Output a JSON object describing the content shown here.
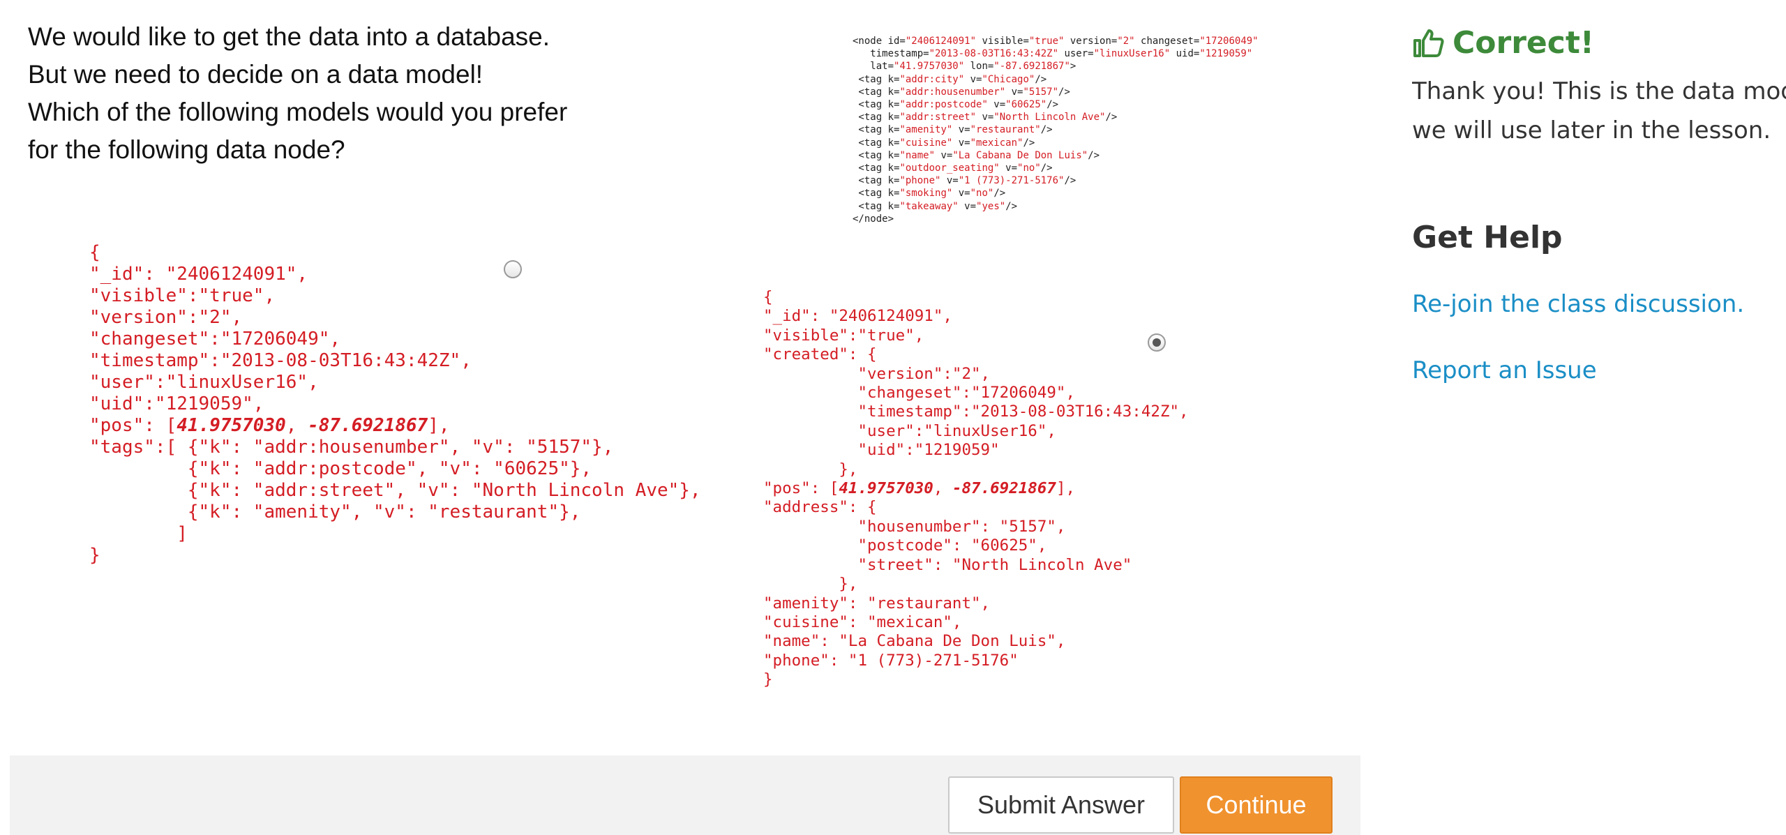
{
  "question": {
    "lines": [
      "We would like to get the data into a database.",
      "But we need to decide on a data model!",
      "Which of the following models would you prefer",
      "for the following data node?"
    ]
  },
  "xml_node": {
    "lines": [
      "<node id=\"2406124091\" visible=\"true\" version=\"2\" changeset=\"17206049\"",
      "   timestamp=\"2013-08-03T16:43:42Z\" user=\"linuxUser16\" uid=\"1219059\"",
      "   lat=\"41.9757030\" lon=\"-87.6921867\">",
      " <tag k=\"addr:city\" v=\"Chicago\"/>",
      " <tag k=\"addr:housenumber\" v=\"5157\"/>",
      " <tag k=\"addr:postcode\" v=\"60625\"/>",
      " <tag k=\"addr:street\" v=\"North Lincoln Ave\"/>",
      " <tag k=\"amenity\" v=\"restaurant\"/>",
      " <tag k=\"cuisine\" v=\"mexican\"/>",
      " <tag k=\"name\" v=\"La Cabana De Don Luis\"/>",
      " <tag k=\"outdoor_seating\" v=\"no\"/>",
      " <tag k=\"phone\" v=\"1 (773)-271-5176\"/>",
      " <tag k=\"smoking\" v=\"no\"/>",
      " <tag k=\"takeaway\" v=\"yes\"/>",
      "</node>"
    ]
  },
  "option_a": {
    "selected": false,
    "lines": [
      "{",
      "\"_id\": \"2406124091\",",
      "\"visible\":\"true\",",
      "\"version\":\"2\",",
      "\"changeset\":\"17206049\",",
      "\"timestamp\":\"2013-08-03T16:43:42Z\",",
      "\"user\":\"linuxUser16\",",
      "\"uid\":\"1219059\",",
      "\"pos\": [41.9757030, -87.6921867],",
      "\"tags\":[ {\"k\": \"addr:housenumber\", \"v\": \"5157\"},",
      "         {\"k\": \"addr:postcode\", \"v\": \"60625\"},",
      "         {\"k\": \"addr:street\", \"v\": \"North Lincoln Ave\"},",
      "         {\"k\": \"amenity\", \"v\": \"restaurant\"},",
      "        ]",
      "}"
    ]
  },
  "option_b": {
    "selected": true,
    "lines": [
      "{",
      "\"_id\": \"2406124091\",",
      "\"visible\":\"true\",",
      "\"created\": {",
      "          \"version\":\"2\",",
      "          \"changeset\":\"17206049\",",
      "          \"timestamp\":\"2013-08-03T16:43:42Z\",",
      "          \"user\":\"linuxUser16\",",
      "          \"uid\":\"1219059\"",
      "        },",
      "\"pos\": [41.9757030, -87.6921867],",
      "\"address\": {",
      "          \"housenumber\": \"5157\",",
      "          \"postcode\": \"60625\",",
      "          \"street\": \"North Lincoln Ave\"",
      "        },",
      "\"amenity\": \"restaurant\",",
      "\"cuisine\": \"mexican\",",
      "\"name\": \"La Cabana De Don Luis\",",
      "\"phone\": \"1 (773)-271-5176\"",
      "}"
    ]
  },
  "footer": {
    "submit_label": "Submit Answer",
    "continue_label": "Continue"
  },
  "sidebar": {
    "result_title": "Correct!",
    "result_message_lines": [
      "Thank you! This is the data model",
      "we will use later in the lesson."
    ],
    "help_title": "Get Help",
    "links": [
      "Re-join the class discussion.",
      "Report an Issue"
    ]
  },
  "colors": {
    "code_red": "#d41d24",
    "correct_green": "#3d8a3a",
    "link_blue": "#1a8ec6",
    "continue_orange": "#f0922e",
    "footer_gray": "#f2f2f2"
  },
  "icons": {
    "result": "thumbs-up-icon"
  }
}
